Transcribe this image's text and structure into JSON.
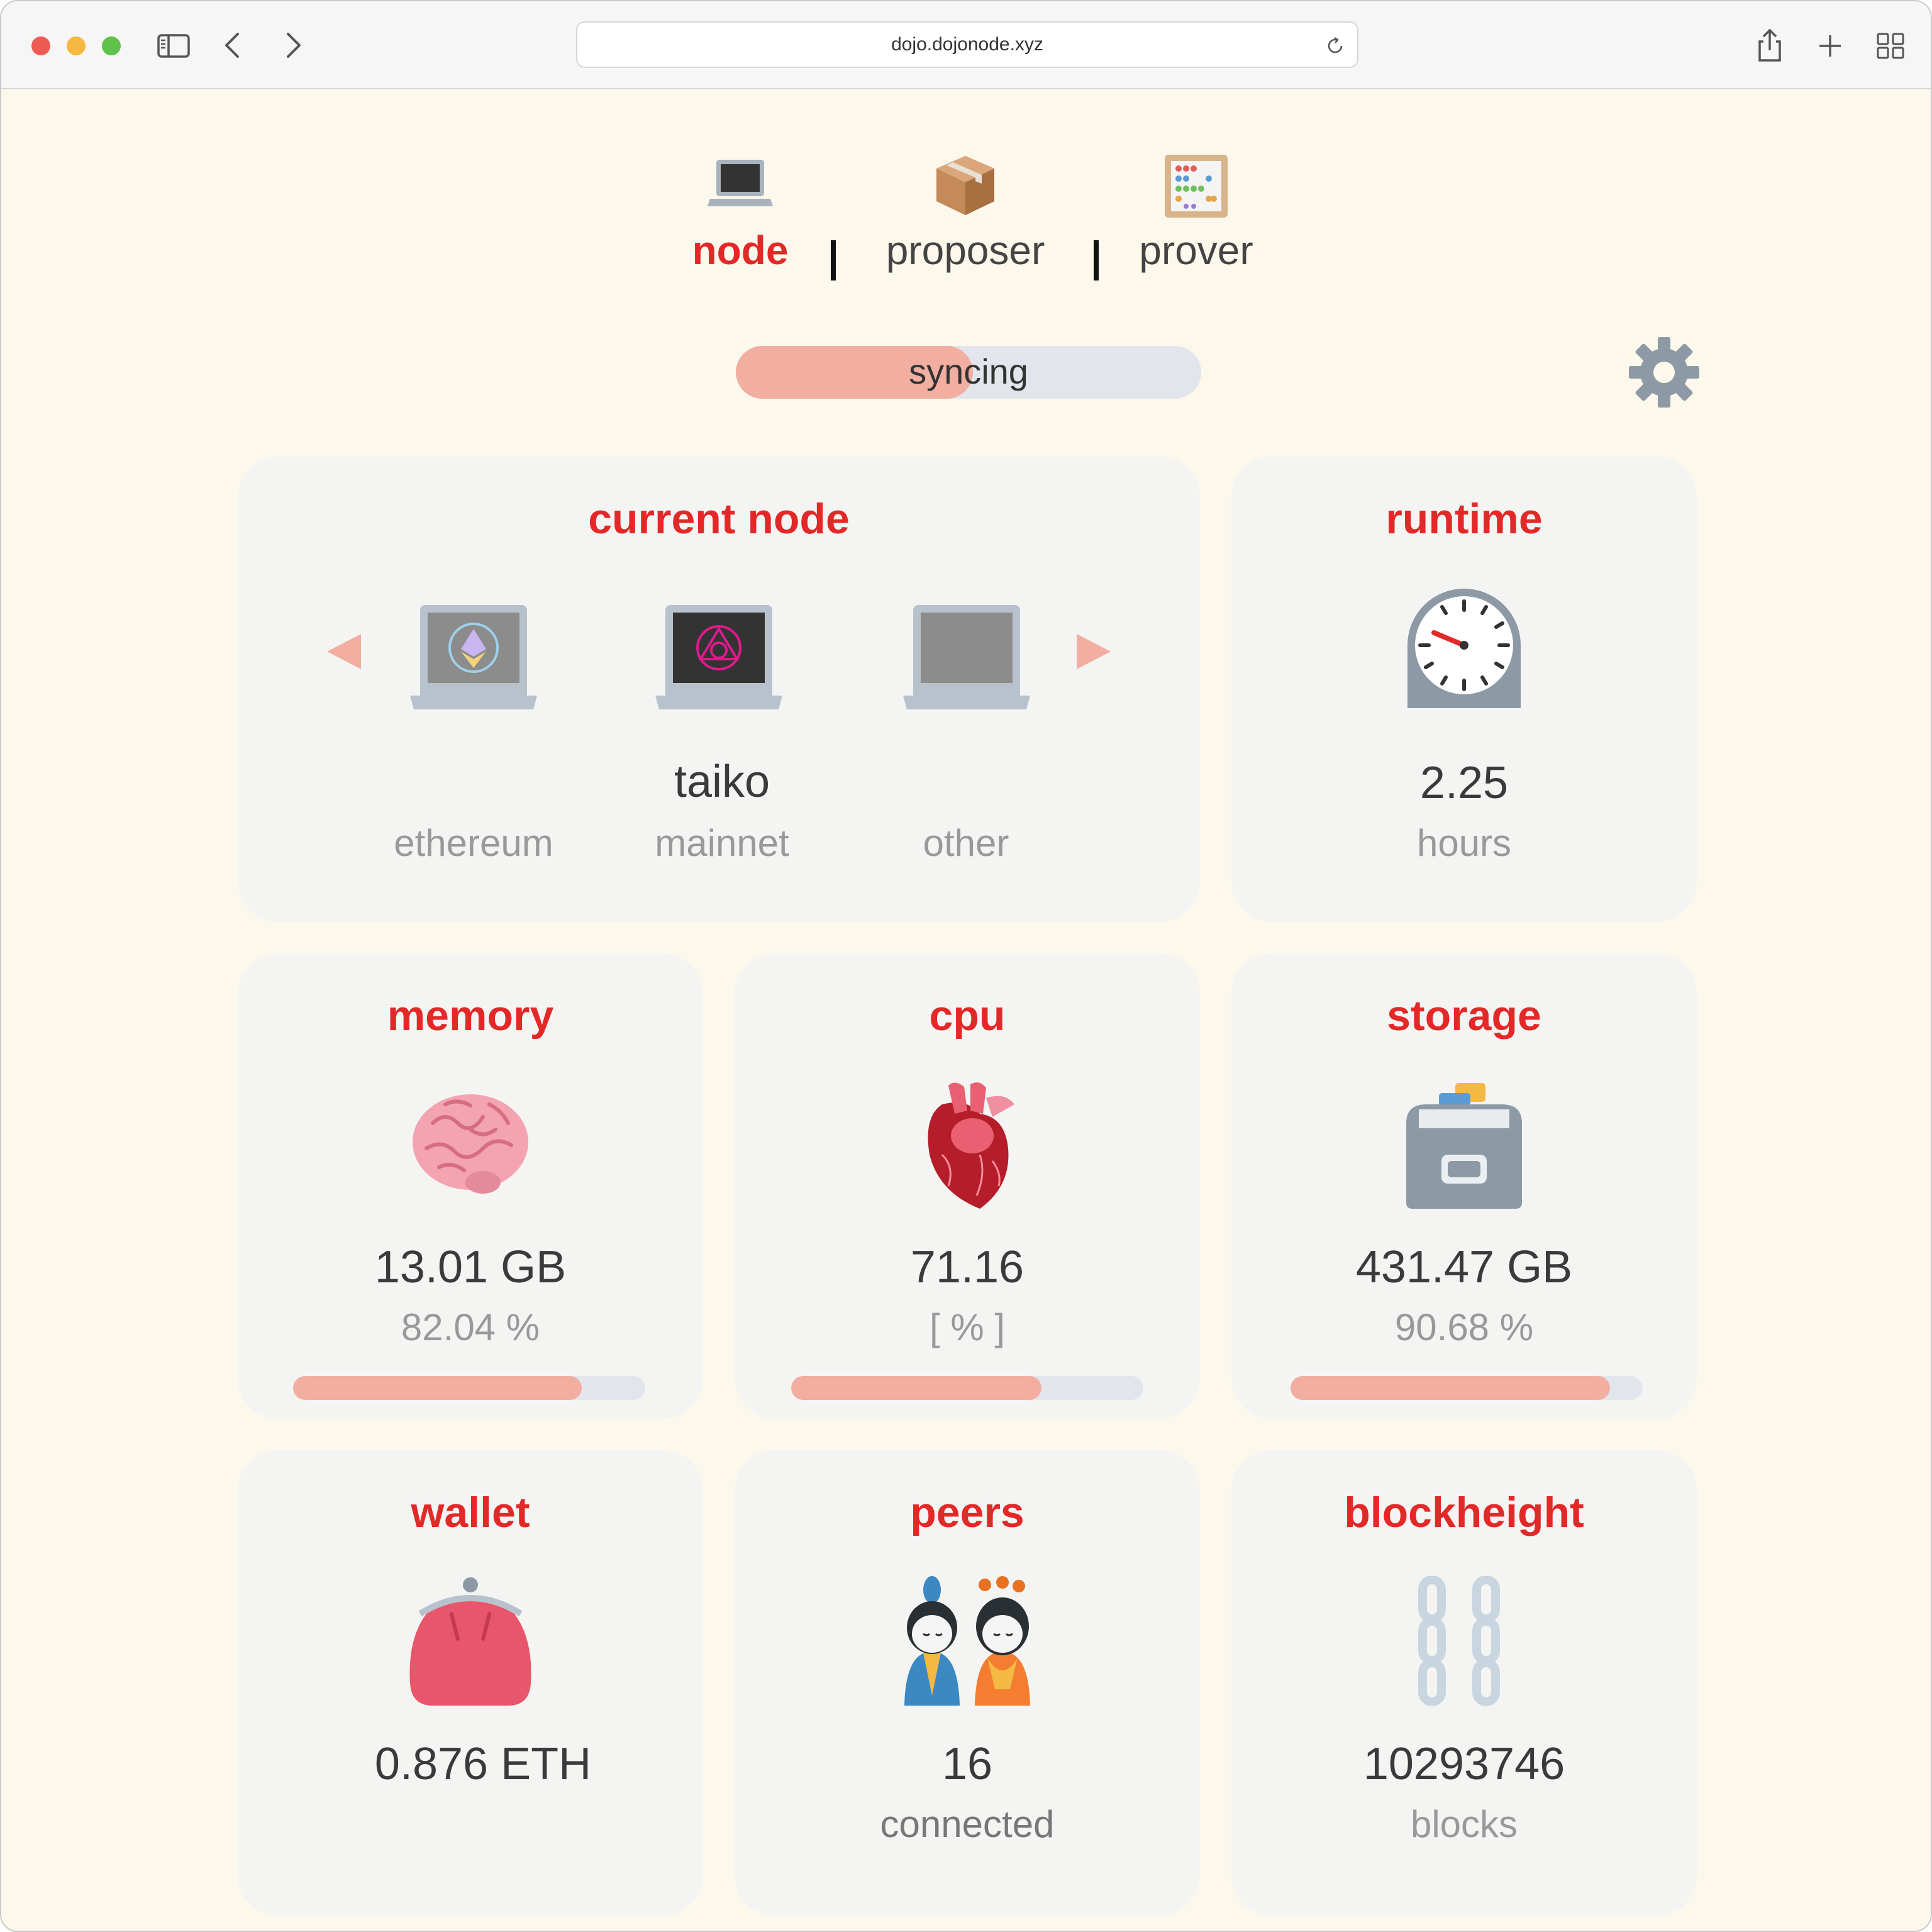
{
  "browser": {
    "url": "dojo.dojonode.xyz",
    "colors": {
      "close": "#ee5b52",
      "minimize": "#f5b941",
      "maximize": "#5fc24a"
    }
  },
  "tabs": [
    {
      "label": "node",
      "icon": "laptop-icon",
      "active": true
    },
    {
      "label": "proposer",
      "icon": "package-icon",
      "active": false
    },
    {
      "label": "prover",
      "icon": "abacus-icon",
      "active": false
    }
  ],
  "status": {
    "label": "syncing",
    "progress": 0.51
  },
  "settings": {
    "icon": "gear-icon"
  },
  "current_node": {
    "title": "current node",
    "nodes": [
      {
        "name": "",
        "label": "ethereum",
        "icon": "ethereum-laptop-icon"
      },
      {
        "name": "taiko",
        "label": "mainnet",
        "icon": "taiko-laptop-icon"
      },
      {
        "name": "",
        "label": "other",
        "icon": "laptop-icon"
      }
    ]
  },
  "runtime": {
    "title": "runtime",
    "value": "2.25",
    "unit": "hours",
    "icon": "clock-icon"
  },
  "memory": {
    "title": "memory",
    "value": "13.01 GB",
    "percent": "82.04 %",
    "progress": 0.8204,
    "icon": "brain-icon"
  },
  "cpu": {
    "title": "cpu",
    "value": "71.16",
    "unit": "[ % ]",
    "progress": 0.7116,
    "icon": "heart-icon"
  },
  "storage": {
    "title": "storage",
    "value": "431.47 GB",
    "percent": "90.68 %",
    "progress": 0.9068,
    "icon": "card-file-box-icon"
  },
  "wallet": {
    "title": "wallet",
    "value": "0.876 ETH",
    "icon": "purse-icon"
  },
  "peers": {
    "title": "peers",
    "value": "16",
    "unit": "connected",
    "icon": "dolls-icon"
  },
  "blockheight": {
    "title": "blockheight",
    "value": "10293746",
    "unit": "blocks",
    "icon": "chains-icon"
  },
  "colors": {
    "accent": "#e32828",
    "progress_fill": "#f2aea0",
    "progress_track": "#e2e6ec",
    "page_bg": "#fcf8ec",
    "card_bg": "#f4f4f3"
  }
}
